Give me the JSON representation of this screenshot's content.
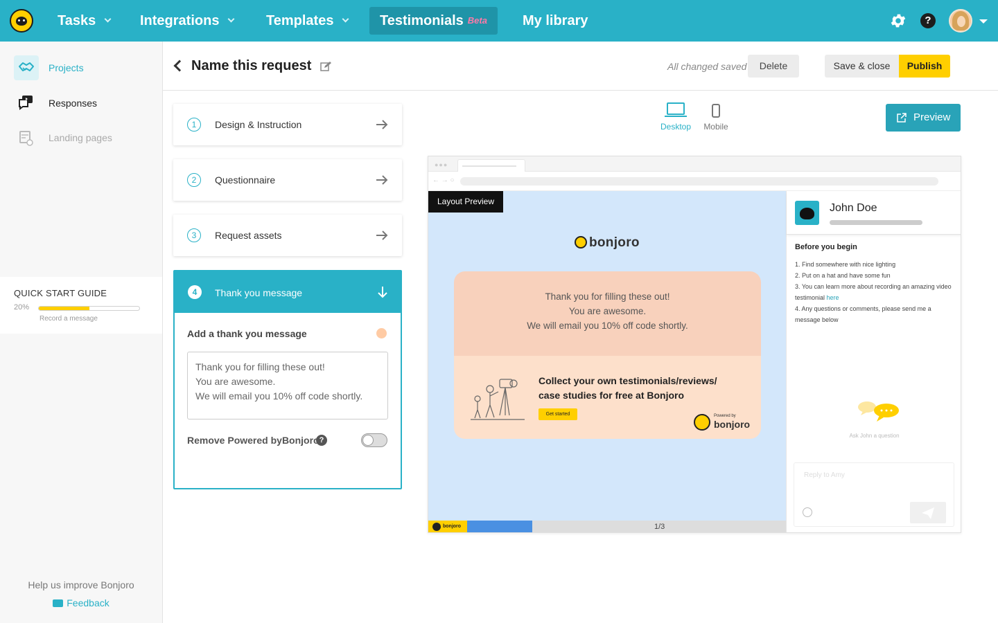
{
  "nav": {
    "items": [
      {
        "label": "Tasks",
        "has_dropdown": true
      },
      {
        "label": "Integrations",
        "has_dropdown": true
      },
      {
        "label": "Templates",
        "has_dropdown": true
      },
      {
        "label": "Testimonials",
        "badge": "Beta",
        "active": true
      },
      {
        "label": "My library"
      }
    ],
    "icons": [
      "bear-logo-icon",
      "gear-icon",
      "help-icon",
      "avatar",
      "caret-down-icon"
    ]
  },
  "sidebar": {
    "items": [
      {
        "label": "Projects",
        "icon": "handshake-icon",
        "active": true
      },
      {
        "label": "Responses",
        "icon": "video-chat-icon"
      },
      {
        "label": "Landing pages",
        "icon": "landing-page-icon",
        "disabled": true
      }
    ],
    "quick_start": {
      "title": "QUICK START GUIDE",
      "percent_label": "20%",
      "progress": 0.2,
      "next_step": "Record a message"
    },
    "help_text": "Help us improve Bonjoro",
    "feedback_label": "Feedback"
  },
  "header": {
    "title": "Name this request",
    "saved_status": "All changed saved",
    "delete_label": "Delete",
    "save_close_label": "Save & close",
    "publish_label": "Publish"
  },
  "steps": [
    {
      "num": "1",
      "label": "Design & Instruction"
    },
    {
      "num": "2",
      "label": "Questionnaire"
    },
    {
      "num": "3",
      "label": "Request assets"
    },
    {
      "num": "4",
      "label": "Thank you message",
      "active": true
    }
  ],
  "thank_you": {
    "field_label": "Add a thank you message",
    "message": "Thank you for filling these out!\nYou are awesome.\nWe will email you 10% off code shortly.",
    "remove_powered_label": "Remove Powered byBonjoro",
    "remove_powered_enabled": false
  },
  "device": {
    "desktop_label": "Desktop",
    "mobile_label": "Mobile",
    "selected": "desktop"
  },
  "preview_label": "Preview",
  "preview": {
    "layout_badge": "Layout Preview",
    "brand": "bonjoro",
    "card_lines": [
      "Thank you for filling these out!",
      "You are awesome.",
      "We will email you 10% off code shortly."
    ],
    "collect_line1": "Collect your own testimonials/reviews/",
    "collect_line2": "case studies for free at Bonjoro",
    "get_started": "Get started",
    "powered_small": "Powered by",
    "powered_brand": "bonjoro",
    "footer_brand": "bonjoro",
    "page_indicator": "1/3",
    "progress": 0.33
  },
  "chat": {
    "name": "John Doe",
    "before_title": "Before you begin",
    "items": [
      "1. Find somewhere with nice lighting",
      "2. Put on a hat and have some fun",
      "3. You can learn more about recording an amazing video testimonial",
      "4. Any questions or comments, please send me a message below"
    ],
    "link_text": "here",
    "ask_text": "Ask John  a question",
    "reply_placeholder": "Reply to Amy"
  },
  "colors": {
    "brand_teal": "#29b1c7",
    "brand_yellow": "#ffcf00",
    "preview_bg": "#d3e7fb",
    "card_top": "#f8d1bc",
    "card_bottom": "#fde0cb"
  }
}
